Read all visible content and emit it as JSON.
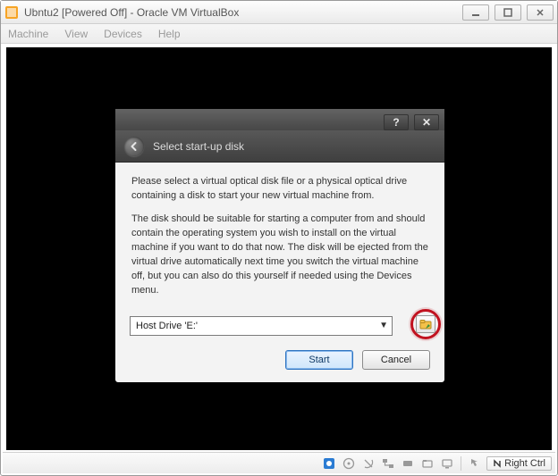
{
  "window": {
    "title": "Ubntu2 [Powered Off] - Oracle VM VirtualBox"
  },
  "menu": {
    "items": [
      "Machine",
      "View",
      "Devices",
      "Help"
    ]
  },
  "dialog": {
    "header_title": "Select start-up disk",
    "paragraph1": "Please select a virtual optical disk file or a physical optical drive containing a disk to start your new virtual machine from.",
    "paragraph2": "The disk should be suitable for starting a computer from and should contain the operating system you wish to install on the virtual machine if you want to do that now. The disk will be ejected from the virtual drive automatically next time you switch the virtual machine off, but you can also do this yourself if needed using the Devices menu.",
    "combo_value": "Host Drive 'E:'",
    "start_label": "Start",
    "cancel_label": "Cancel",
    "help_btn": "?",
    "close_btn": "✕"
  },
  "statusbar": {
    "hostkey_label": "Right Ctrl"
  }
}
